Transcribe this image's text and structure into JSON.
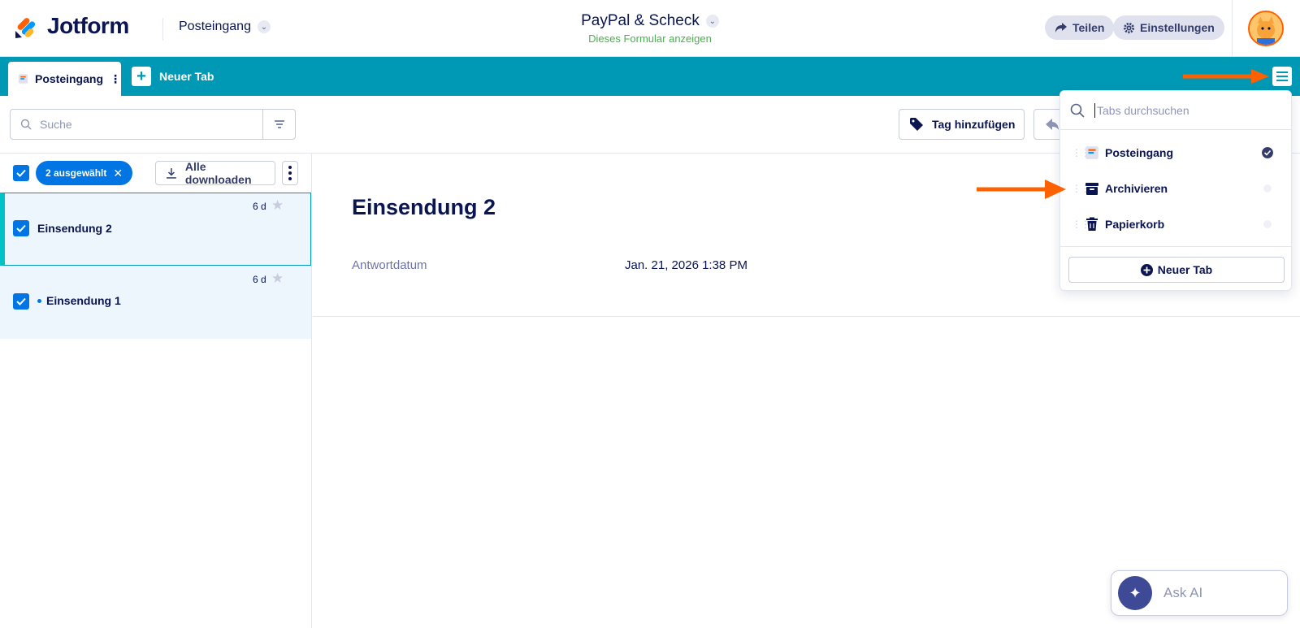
{
  "header": {
    "logo_text": "Jotform",
    "inbox_label": "Posteingang",
    "form_name": "PayPal & Scheck",
    "view_form_link": "Dieses Formular anzeigen",
    "share_label": "Teilen",
    "settings_label": "Einstellungen"
  },
  "tabs": {
    "active_label": "Posteingang",
    "new_tab_label": "Neuer Tab"
  },
  "toolbar": {
    "search_placeholder": "Suche",
    "add_tag_label": "Tag hinzufügen"
  },
  "list": {
    "selected_count_label": "2 ausgewählt",
    "download_all_label": "Alle downloaden",
    "rows": [
      {
        "title": "Einsendung 2",
        "age": "6 d",
        "selected": true,
        "unread": false
      },
      {
        "title": "Einsendung 1",
        "age": "6 d",
        "selected": false,
        "unread": true
      }
    ]
  },
  "detail": {
    "title": "Einsendung 2",
    "field_label": "Antwortdatum",
    "field_value": "Jan. 21, 2026 1:38 PM"
  },
  "tabs_menu": {
    "search_placeholder": "Tabs durchsuchen",
    "items": [
      {
        "label": "Posteingang",
        "icon": "inbox-icon",
        "active": true
      },
      {
        "label": "Archivieren",
        "icon": "archive-icon",
        "active": false
      },
      {
        "label": "Papierkorb",
        "icon": "trash-icon",
        "active": false
      }
    ],
    "new_tab_label": "Neuer Tab"
  },
  "ask_ai": {
    "label": "Ask AI"
  },
  "colors": {
    "brand_navy": "#0a1551",
    "tab_bar": "#0099b5",
    "accent_blue": "#0075e3",
    "annotation_orange": "#ff6100",
    "link_green": "#4caf50"
  }
}
